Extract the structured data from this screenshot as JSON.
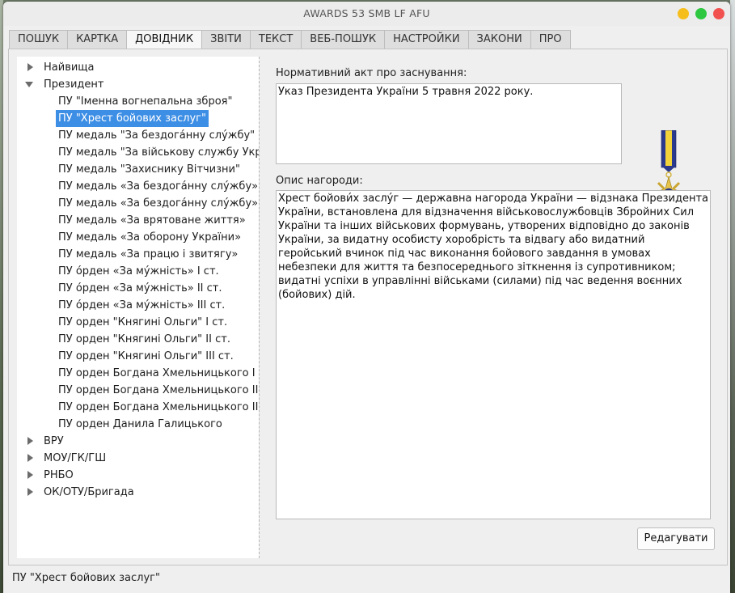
{
  "window": {
    "title": "AWARDS 53 SMB LF AFU",
    "colors": {
      "minimize": "#f6be1d",
      "maximize": "#2ec840",
      "close": "#f1524f"
    }
  },
  "tabs": [
    {
      "label": "ПОШУК"
    },
    {
      "label": "КАРТКА"
    },
    {
      "label": "ДОВІДНИК",
      "active": true
    },
    {
      "label": "ЗВІТИ"
    },
    {
      "label": "ТЕКСТ"
    },
    {
      "label": "ВЕБ-ПОШУК"
    },
    {
      "label": "НАСТРОЙКИ"
    },
    {
      "label": "ЗАКОНИ"
    },
    {
      "label": "ПРО"
    }
  ],
  "tree": {
    "groups": [
      {
        "label": "Найвища",
        "expanded": false
      },
      {
        "label": "Президент",
        "expanded": true
      },
      {
        "label": "ВРУ",
        "expanded": false
      },
      {
        "label": "МОУ/ГК/ГШ",
        "expanded": false
      },
      {
        "label": "РНБО",
        "expanded": false
      },
      {
        "label": "ОК/ОТУ/Бригада",
        "expanded": false
      }
    ],
    "president_items": [
      "ПУ \"Іменна вогнепальна зброя\"",
      "ПУ \"Хрест бойових заслуг\"",
      "ПУ медаль \"За бездога́нну слу́жбу\" III ст.",
      "ПУ медаль \"За військову службу Україні\"",
      "ПУ медаль \"Захиснику Вітчизни\"",
      "ПУ медаль «За бездога́нну слу́жбу» I ст.",
      "ПУ медаль «За бездога́нну слу́жбу» II ст.",
      "ПУ медаль «За врятоване життя»",
      "ПУ медаль «За оборону України»",
      "ПУ медаль «За працю і звитягу»",
      "ПУ о́рден «За му́жність» I ст.",
      "ПУ о́рден «За му́жність» II ст.",
      "ПУ о́рден «За му́жність» III ст.",
      "ПУ орден \"Княгині Ольги\" I ст.",
      "ПУ орден \"Княгині Ольги\" II ст.",
      "ПУ орден \"Княгині Ольги\" III ст.",
      "ПУ орден Богдана Хмельницького I ст.",
      "ПУ орден Богдана Хмельницького II ст.",
      "ПУ орден Богдана Хмельницького III ст.",
      "ПУ орден Данила Галицького"
    ],
    "selected_index": 1,
    "selection_color": "#3d8ee5"
  },
  "detail": {
    "normative_label": "Нормативний акт про заснування:",
    "normative_value": "Указ Президента України 5 травня 2022 року.",
    "description_label": "Опис нагороди:",
    "description_value": "Хрест бойови́х заслу́г  — державна нагорода України — відзнака Президента України, встановлена для відзначення військовослужбовців Збройних Сил України та інших військових формувань, утворених відповідно до законів України, за видатну особисту хоробрість та відвагу або видатний геройський вчинок під час виконання бойового завдання в умовах небезпеки для життя та безпосереднього зіткнення із супротивником; видатні успіхи в управлінні військами (силами) під час ведення воєнних (бойових) дій.",
    "edit_button": "Редагувати",
    "medal_image": "medal-cross-icon",
    "ribbon_colors": {
      "blue": "#2b3a8c",
      "yellow": "#f2d33a"
    }
  },
  "statusbar": {
    "text": "ПУ \"Хрест бойових заслуг\""
  }
}
